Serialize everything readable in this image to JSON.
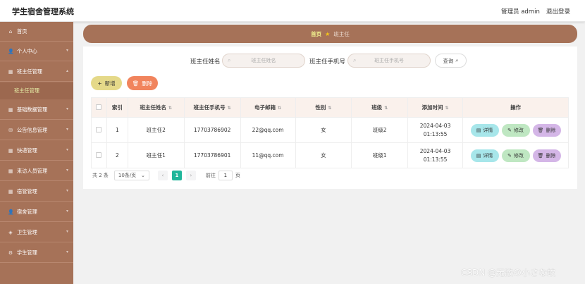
{
  "header": {
    "title": "学生宿舍管理系统",
    "user": "管理员 admin",
    "logout": "退出登录"
  },
  "sidebar": {
    "items": [
      {
        "label": "首页",
        "icon": "home-icon",
        "glyph": "⌂"
      },
      {
        "label": "个人中心",
        "icon": "user-icon",
        "glyph": "👤"
      },
      {
        "label": "班主任管理",
        "icon": "grid-icon",
        "glyph": "▦"
      },
      {
        "label": "基础数据管理",
        "icon": "grid-icon",
        "glyph": "▦"
      },
      {
        "label": "公告信息管理",
        "icon": "mail-icon",
        "glyph": "✉"
      },
      {
        "label": "快递管理",
        "icon": "grid-icon",
        "glyph": "▦"
      },
      {
        "label": "来访人员管理",
        "icon": "grid-icon",
        "glyph": "▦"
      },
      {
        "label": "宿管管理",
        "icon": "grid-icon",
        "glyph": "▦"
      },
      {
        "label": "宿舍管理",
        "icon": "user-icon",
        "glyph": "👤"
      },
      {
        "label": "卫生管理",
        "icon": "shield-icon",
        "glyph": "◈"
      },
      {
        "label": "学生管理",
        "icon": "gear-icon",
        "glyph": "⚙"
      }
    ],
    "sub_item": "班主任管理"
  },
  "breadcrumb": {
    "home": "首页",
    "current": "班主任"
  },
  "search": {
    "name_label": "班主任姓名",
    "name_placeholder": "班主任姓名",
    "phone_label": "班主任手机号",
    "phone_placeholder": "班主任手机号",
    "query": "查询"
  },
  "actions": {
    "add": "新增",
    "delete": "删除"
  },
  "table": {
    "headers": [
      "索引",
      "班主任姓名",
      "班主任手机号",
      "电子邮箱",
      "性别",
      "班级",
      "添加时间",
      "操作"
    ],
    "rows": [
      {
        "index": "1",
        "name": "班主任2",
        "phone": "17703786902",
        "email": "22@qq.com",
        "gender": "女",
        "class": "班级2",
        "time": "2024-04-03 01:13:55"
      },
      {
        "index": "2",
        "name": "班主任1",
        "phone": "17703786901",
        "email": "11@qq.com",
        "gender": "女",
        "class": "班级1",
        "time": "2024-04-03 01:13:55"
      }
    ],
    "op_detail": "详情",
    "op_edit": "修改",
    "op_delete": "删除"
  },
  "pagination": {
    "total": "共 2 条",
    "page_size": "10条/页",
    "current_page": "1",
    "goto_label": "前往",
    "goto_value": "1",
    "page_unit": "页"
  },
  "watermark": "CSDN @无敌の小さな蚊",
  "colors": {
    "sidebar": "#a67258",
    "accent_green": "#20b69a",
    "add": "#e5d989",
    "delete": "#f1845d"
  }
}
